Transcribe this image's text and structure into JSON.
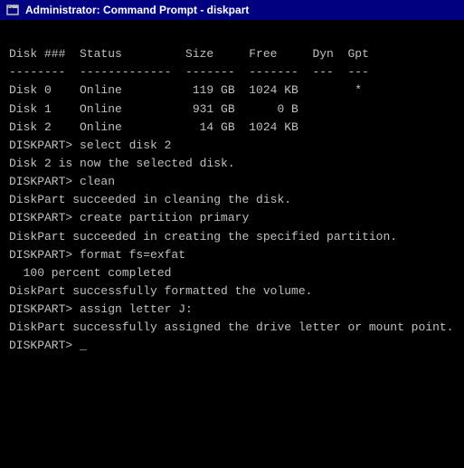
{
  "titleBar": {
    "icon": "C>",
    "title": "Administrator: Command Prompt - diskpart"
  },
  "terminal": {
    "lines": [
      "",
      "Disk ###  Status         Size     Free     Dyn  Gpt",
      "--------  -------------  -------  -------  ---  ---",
      "Disk 0    Online          119 GB  1024 KB        *",
      "Disk 1    Online          931 GB      0 B",
      "Disk 2    Online           14 GB  1024 KB",
      "",
      "DISKPART> select disk 2",
      "",
      "Disk 2 is now the selected disk.",
      "",
      "DISKPART> clean",
      "",
      "DiskPart succeeded in cleaning the disk.",
      "",
      "DISKPART> create partition primary",
      "",
      "DiskPart succeeded in creating the specified partition.",
      "",
      "DISKPART> format fs=exfat",
      "",
      "  100 percent completed",
      "",
      "DiskPart successfully formatted the volume.",
      "",
      "DISKPART> assign letter J:",
      "",
      "DiskPart successfully assigned the drive letter or mount point.",
      "",
      "DISKPART> _"
    ]
  }
}
